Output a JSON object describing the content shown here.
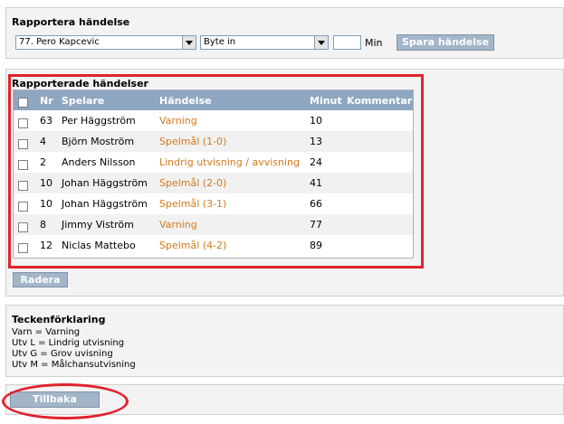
{
  "report": {
    "title": "Rapportera händelse",
    "player_select": "77. Pero Kapcevic",
    "event_select": "Byte in",
    "minute_value": "",
    "minute_label": "Min",
    "save_button": "Spara händelse"
  },
  "reported": {
    "title": "Rapporterade händelser",
    "headers": {
      "nr": "Nr",
      "player": "Spelare",
      "event": "Händelse",
      "minute": "Minut",
      "comment": "Kommentar"
    },
    "rows": [
      {
        "nr": "63",
        "player": "Per Häggström",
        "event": "Varning",
        "minute": "10",
        "comment": ""
      },
      {
        "nr": "4",
        "player": "Björn Moström",
        "event": "Spelmål (1-0)",
        "minute": "13",
        "comment": ""
      },
      {
        "nr": "2",
        "player": "Anders Nilsson",
        "event": "Lindrig utvisning / avvisning",
        "minute": "24",
        "comment": ""
      },
      {
        "nr": "10",
        "player": "Johan Häggström",
        "event": "Spelmål (2-0)",
        "minute": "41",
        "comment": ""
      },
      {
        "nr": "10",
        "player": "Johan Häggström",
        "event": "Spelmål (3-1)",
        "minute": "66",
        "comment": ""
      },
      {
        "nr": "8",
        "player": "Jimmy Viström",
        "event": "Varning",
        "minute": "77",
        "comment": ""
      },
      {
        "nr": "12",
        "player": "Niclas Mattebo",
        "event": "Spelmål (4-2)",
        "minute": "89",
        "comment": ""
      }
    ],
    "delete_button": "Radera"
  },
  "legend": {
    "title": "Teckenförklaring",
    "items": [
      "Varn = Varning",
      "Utv L = Lindrig utvisning",
      "Utv G = Grov uvisning",
      "Utv M = Målchansutvisning"
    ]
  },
  "back_button": "Tillbaka",
  "colors": {
    "header": "#8ea6bf",
    "button": "#a3b5c8",
    "event_text": "#d37a1c",
    "highlight": "#e0232c"
  }
}
